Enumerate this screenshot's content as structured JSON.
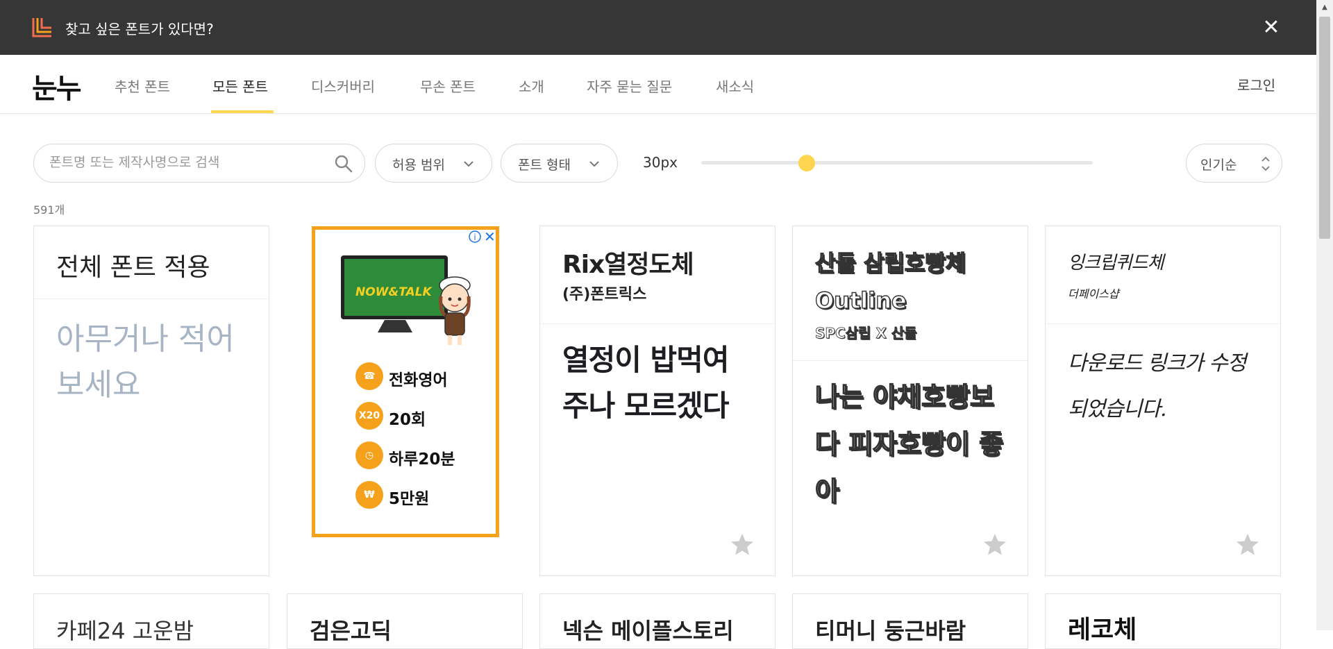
{
  "banner": {
    "text": "찾고 싶은 폰트가 있다면?",
    "close": "✕"
  },
  "nav": {
    "brand": "눈누",
    "items": [
      "추천 폰트",
      "모든 폰트",
      "디스커버리",
      "무손 폰트",
      "소개",
      "자주 묻는 질문",
      "새소식"
    ],
    "active": "모든 폰트",
    "login": "로그인"
  },
  "filters": {
    "search_placeholder": "폰트명 또는 제작사명으로 검색",
    "license": "허용 범위",
    "form": "폰트 형태",
    "size": "30px",
    "size_fraction": 0.27,
    "sort": "인기순"
  },
  "count": "591개",
  "cards": [
    {
      "title": "전체 폰트 적용",
      "sample": "아무거나 적어 보세요"
    },
    {
      "title": "Rix열정도체",
      "maker": "(주)폰트릭스",
      "sample": "열정이 밥먹여 주나 모르겠다"
    },
    {
      "title": "산돌 삼립호빵체 Outline",
      "maker": "SPC삼립 X 산돌",
      "sample": "나는 야채호빵보다 피자호빵이 좋아"
    },
    {
      "title": "잉크립퀴드체",
      "maker": "더페이스샵",
      "sample": "다운로드 링크가 수정되었습니다."
    }
  ],
  "ad": {
    "brand": "NOW&TALK",
    "rows": [
      {
        "icon": "phone-icon",
        "text": "전화영어"
      },
      {
        "icon": "x20-icon",
        "badge": "X20",
        "text": "20회"
      },
      {
        "icon": "clock-icon",
        "text": "하루20분"
      },
      {
        "icon": "won-icon",
        "badge": "₩",
        "text": "5만원"
      }
    ]
  },
  "next_row": [
    "카페24 고운밤",
    "검은고딕",
    "넥슨 메이플스토리",
    "티머니 둥근바람",
    "레코체"
  ],
  "colors": {
    "banner_bg": "#363636",
    "accent": "#ffd54f",
    "ad_border": "#f5a11b",
    "placeholder_text": "#a7b4c4"
  }
}
